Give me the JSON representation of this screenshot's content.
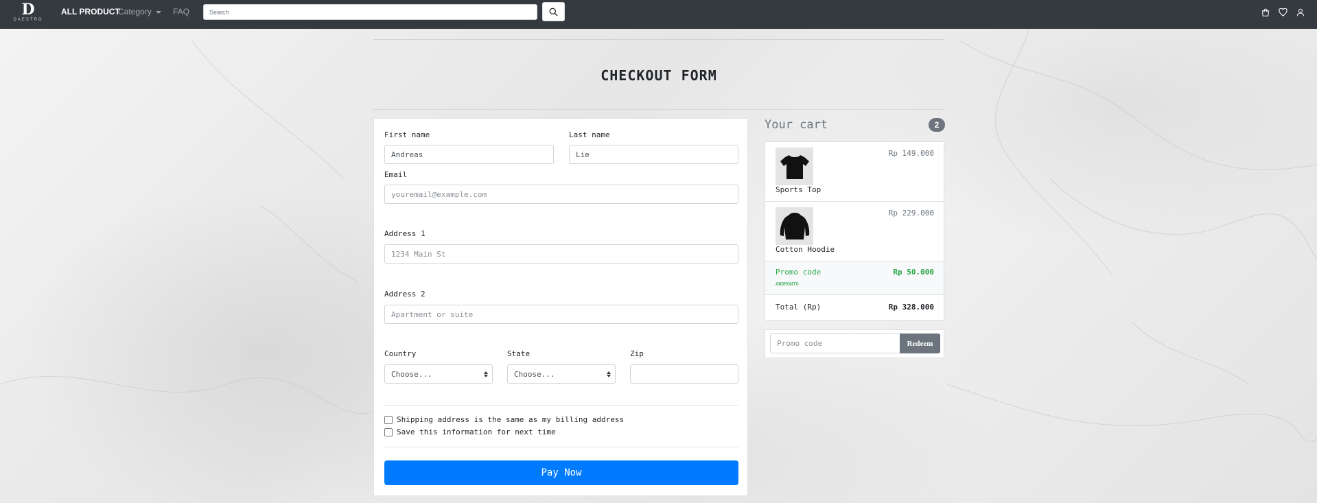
{
  "brand": {
    "logo_mark": "D",
    "logo_text": "DAESTRO"
  },
  "nav": {
    "all_product": "ALL PRODUCT",
    "category": "Category",
    "faq": "FAQ",
    "search_placeholder": "Search"
  },
  "page": {
    "title": "CHECKOUT FORM"
  },
  "form": {
    "first_name_label": "First name",
    "first_name_value": "Andreas",
    "last_name_label": "Last name",
    "last_name_value": "Lie",
    "email_label": "Email",
    "email_placeholder": "youremail@example.com",
    "address1_label": "Address 1",
    "address1_placeholder": "1234 Main St",
    "address2_label": "Address 2",
    "address2_placeholder": "Apartment or suite",
    "country_label": "Country",
    "country_value": "Choose...",
    "state_label": "State",
    "state_value": "Choose...",
    "zip_label": "Zip",
    "zip_value": "",
    "same_address_label": "Shipping address is the same as my billing address",
    "save_info_label": "Save this information for next time",
    "pay_button": "Pay Now"
  },
  "cart": {
    "title": "Your cart",
    "count": "2",
    "items": [
      {
        "name": "Sports Top",
        "price": "Rp 149.000"
      },
      {
        "name": "Cotton Hoodie",
        "price": "Rp 229.000"
      }
    ],
    "promo": {
      "label": "Promo code",
      "code": "ANDRGNTG",
      "amount": "Rp 50.000"
    },
    "total_label": "Total (Rp)",
    "total_amount": "Rp 328.000",
    "promo_placeholder": "Promo code",
    "redeem_button": "Redeem"
  },
  "colors": {
    "navbar": "#343a40",
    "primary": "#007bff",
    "success": "#28a745",
    "secondary": "#6c757d"
  }
}
